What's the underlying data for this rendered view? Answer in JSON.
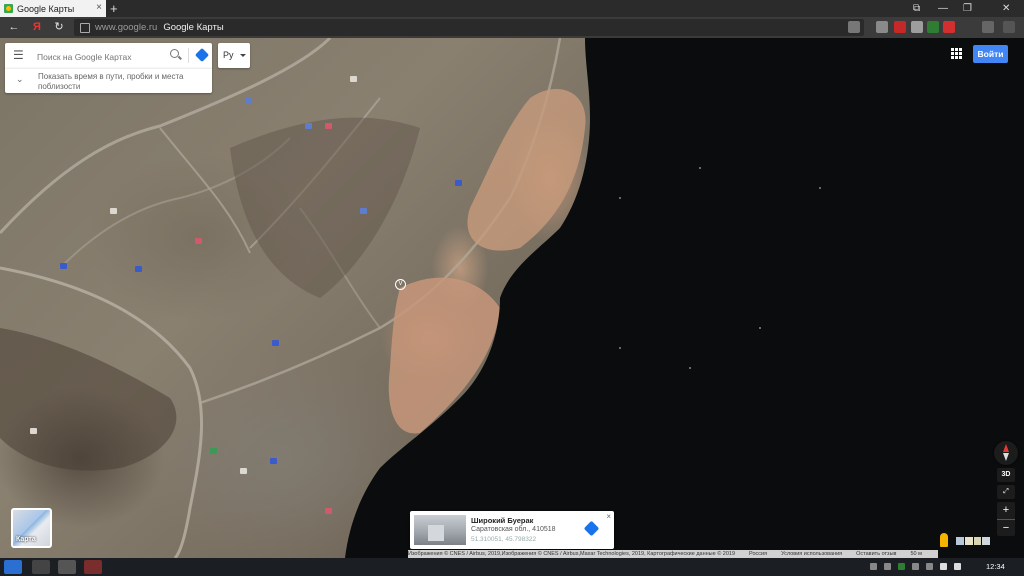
{
  "browser": {
    "tab_title": "Google Карты",
    "new_tab": "+",
    "tab_close": "×",
    "address_url": "www.google.ru",
    "address_title": "Google Карты",
    "nav_back": "←",
    "nav_yandex": "Я",
    "nav_reload": "↻",
    "window_controls": [
      "⧉",
      "—",
      "❐",
      "✕"
    ]
  },
  "search": {
    "placeholder": "Поиск на Google Картах",
    "menu_glyph": "☰",
    "travel_text": "Показать время в пути, пробки и места поблизости",
    "travel_chevron": "⌄",
    "language": "Ру"
  },
  "header": {
    "signin_label": "Войти"
  },
  "map": {
    "marker_glyph": "V",
    "controls": {
      "three_d": "3D",
      "expand": "⤢",
      "zoom_in": "+",
      "zoom_out": "−"
    },
    "layer_label": "Карта"
  },
  "place_card": {
    "name": "Широкий Буерак",
    "address": "Саратовская обл., 410518",
    "coords": "51.310051, 45.798322",
    "close": "×"
  },
  "attribution": {
    "items": [
      "Изображения © CNES / Airbus, 2019,Изображения © CNES / Airbus,Maxar Technologies, 2019, Картографические данные © 2019",
      "Россия",
      "Условия использования",
      "Оставить отзыв",
      "50 м"
    ]
  },
  "taskbar": {
    "clock": "12:34"
  },
  "colors": {
    "accent_blue": "#4285f4",
    "water": "#0a0c0e",
    "sand": "#c9987a"
  }
}
